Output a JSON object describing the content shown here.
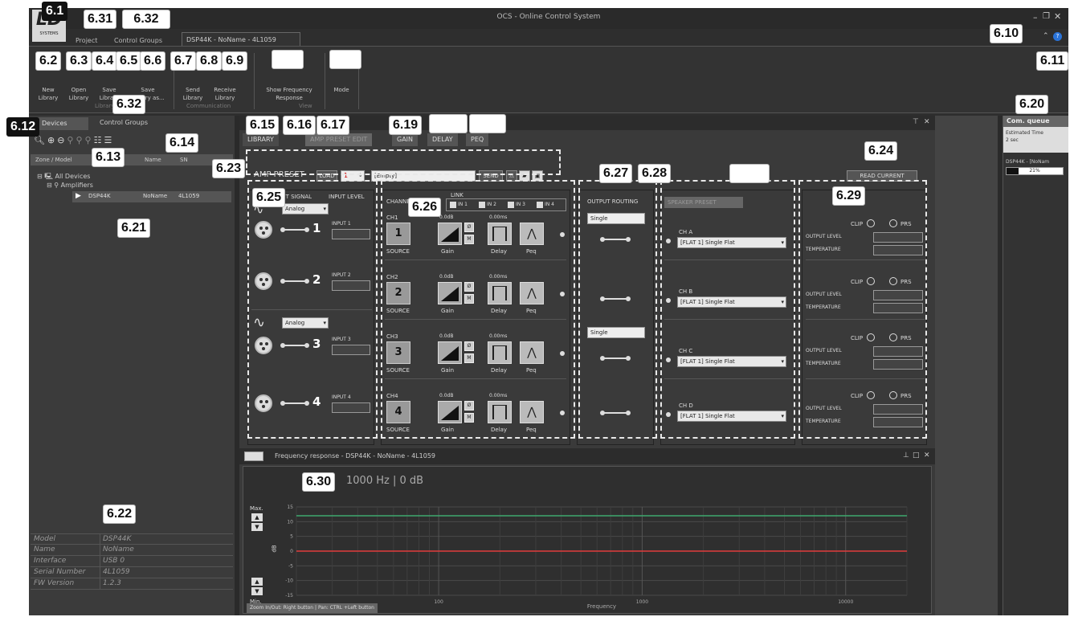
{
  "window": {
    "title": "OCS - Online Control System"
  },
  "logo": {
    "text": "LD",
    "sub": "SYSTEMS"
  },
  "menu": {
    "project": "Project",
    "control_groups": "Control Groups",
    "doc_tab": "DSP44K - NoName - 4L1059"
  },
  "ribbon": {
    "new_library": "New\nLibrary",
    "open_library": "Open\nLibrary",
    "save_library": "Save\nLibrary",
    "save_library_as": "Save\nLibrary as...",
    "send_library": "Send\nLibrary",
    "receive_library": "Receive\nLibrary",
    "show_frequency_response": "Show Frequency\nResponse",
    "mode": "Mode",
    "group_library": "Library",
    "group_communication": "Communication",
    "group_view": "View"
  },
  "left_panel": {
    "tab_devices": "Devices",
    "tab_control_groups": "Control Groups",
    "col_zone_model": "Zone / Model",
    "col_name": "Name",
    "col_sn": "SN",
    "tree_root": "All Devices",
    "tree_group": "Amplifiers",
    "tree_device_model": "DSP44K",
    "tree_device_name": "NoName",
    "tree_device_sn": "4L1059",
    "props": [
      {
        "label": "Model",
        "value": "DSP44K"
      },
      {
        "label": "Name",
        "value": "NoName"
      },
      {
        "label": "Interface",
        "value": "USB 0"
      },
      {
        "label": "Serial Number",
        "value": "4L1059"
      },
      {
        "label": "FW Version",
        "value": "1.2.3"
      }
    ]
  },
  "panel_tabs": {
    "library": "LIBRARY",
    "amp_preset_edit": "AMP PRESET EDIT",
    "gain": "GAIN",
    "delay": "DELAY",
    "peq": "PEQ"
  },
  "amp_preset": {
    "label": "AMP PRESET",
    "load": "LOAD",
    "number": "1",
    "name": "[Empty]",
    "send": "SEND",
    "read_current": "READ CURRENT"
  },
  "input": {
    "header_signal": "INPUT SIGNAL",
    "header_level": "INPUT LEVEL",
    "analog": "Analog",
    "channels": [
      "1",
      "2",
      "3",
      "4"
    ],
    "labels": [
      "INPUT 1",
      "INPUT 2",
      "INPUT 3",
      "INPUT 4"
    ]
  },
  "channel_edit": {
    "header": "CHANNEL EDIT",
    "link": "LINK",
    "link_items": [
      "IN 1",
      "IN 2",
      "IN 3",
      "IN 4"
    ],
    "rows": [
      {
        "ch": "CH1",
        "num": "1",
        "gain_val": "0.0dB",
        "delay_val": "0.00ms"
      },
      {
        "ch": "CH2",
        "num": "2",
        "gain_val": "0.0dB",
        "delay_val": "0.00ms"
      },
      {
        "ch": "CH3",
        "num": "3",
        "gain_val": "0.0dB",
        "delay_val": "0.00ms"
      },
      {
        "ch": "CH4",
        "num": "4",
        "gain_val": "0.0dB",
        "delay_val": "0.00ms"
      }
    ],
    "source": "SOURCE",
    "gain": "Gain",
    "delay": "Delay",
    "peq": "Peq",
    "phase": "Ø",
    "mute": "M"
  },
  "output_routing": {
    "header": "OUTPUT ROUTING",
    "mode1": "Single",
    "mode2": "Single"
  },
  "speaker_preset": {
    "header": "SPEAKER PRESET",
    "rows": [
      {
        "ch": "CH A",
        "preset": "[FLAT 1] Single Flat"
      },
      {
        "ch": "CH B",
        "preset": "[FLAT 1] Single Flat"
      },
      {
        "ch": "CH C",
        "preset": "[FLAT 1] Single Flat"
      },
      {
        "ch": "CH D",
        "preset": "[FLAT 1] Single Flat"
      }
    ]
  },
  "status": {
    "clip": "CLIP",
    "prs": "PRS",
    "output_level": "OUTPUT LEVEL",
    "temperature": "TEMPERATURE"
  },
  "comm_queue": {
    "title": "Com. queue",
    "est_label": "Estimated Time",
    "est_value": "2 sec",
    "device": "DSP44K - [NoNam",
    "progress_text": "21%",
    "progress": 0.21
  },
  "freq": {
    "title": "Frequency response - DSP44K - NoName - 4L1059",
    "readout": "1000 Hz | 0 dB",
    "max": "Max.",
    "min": "Min.",
    "db": "dB",
    "y_ticks": [
      "15",
      "10",
      "5",
      "0",
      "-5",
      "-10",
      "-15"
    ],
    "x_ticks": [
      "100",
      "1000",
      "10000"
    ],
    "xlabel": "Frequency",
    "hint": "Zoom In/Out: Right button | Pan: CTRL +Left button"
  },
  "callouts": {
    "c6_1": "6.1",
    "c6_2": "6.2",
    "c6_3": "6.3",
    "c6_4": "6.4",
    "c6_5": "6.5",
    "c6_6": "6.6",
    "c6_7": "6.7",
    "c6_8": "6.8",
    "c6_9": "6.9",
    "c6_10": "6.10",
    "c6_11": "6.11",
    "c6_12": "6.12",
    "c6_13": "6.13",
    "c6_14": "6.14",
    "c6_15": "6.15",
    "c6_16": "6.16",
    "c6_17": "6.17",
    "c6_19": "6.19",
    "c6_20": "6.20",
    "c6_21": "6.21",
    "c6_22": "6.22",
    "c6_23": "6.23",
    "c6_24": "6.24",
    "c6_25": "6.25",
    "c6_26": "6.26",
    "c6_27": "6.27",
    "c6_28": "6.28",
    "c6_29": "6.29",
    "c6_30": "6.30",
    "c6_31": "6.31",
    "c6_32": "6.32"
  },
  "colors": {
    "bg": "#2e2e2e",
    "panel": "#3a3a3a",
    "green_line": "#3ea86e",
    "red_line": "#e23b3b",
    "accent_blue": "#2a73d8"
  }
}
